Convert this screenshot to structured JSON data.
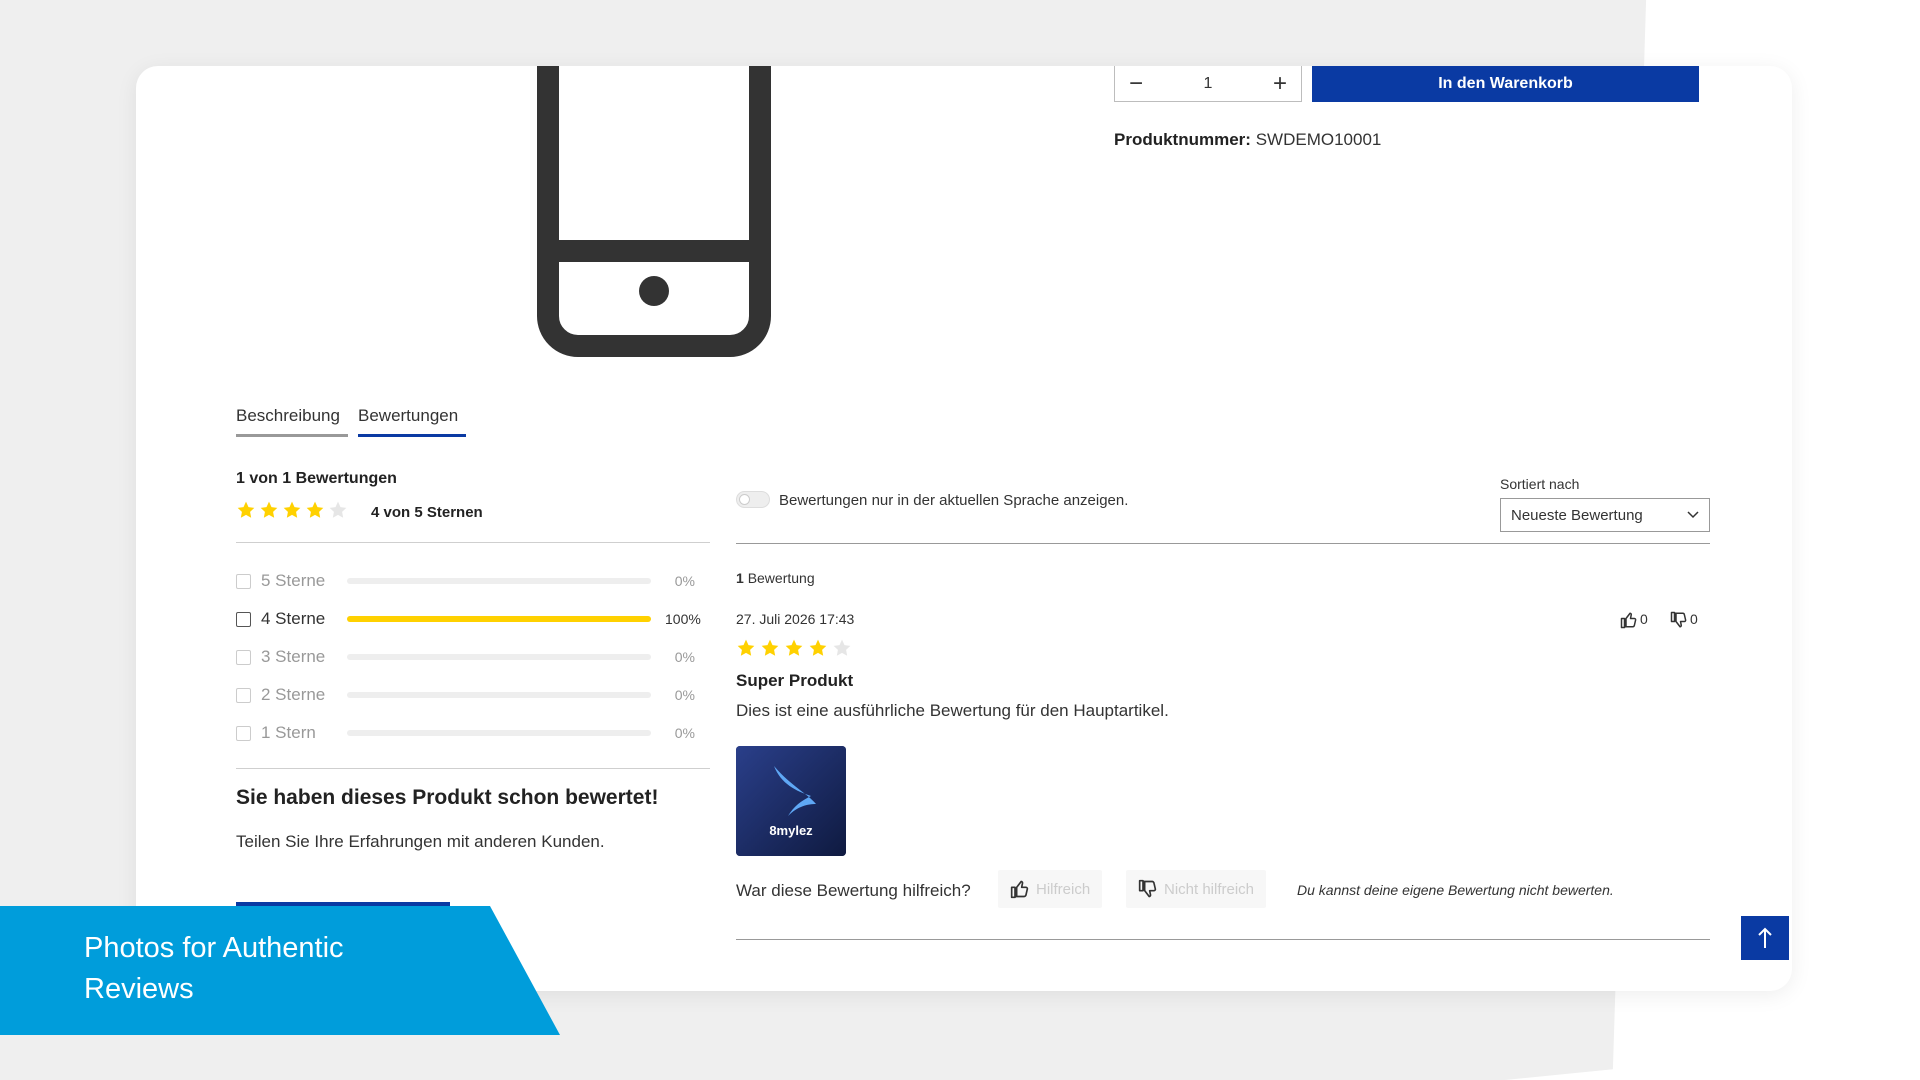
{
  "product": {
    "quantity": "1",
    "qty_minus": "−",
    "qty_plus": "+",
    "cart_button": "In den Warenkorb",
    "product_number_label": "Produktnummer:",
    "product_number_value": "SWDEMO10001"
  },
  "tabs": [
    {
      "label": "Beschreibung"
    },
    {
      "label": "Bewertungen"
    }
  ],
  "summary": {
    "title": "1 von 1 Bewertungen",
    "stars_filled": 4,
    "stars_total": 5,
    "stars_text": "4 von 5 Sternen"
  },
  "rating_filters": [
    {
      "label": "5 Sterne",
      "percent": 0,
      "percent_text": "0%"
    },
    {
      "label": "4 Sterne",
      "percent": 100,
      "percent_text": "100%"
    },
    {
      "label": "3 Sterne",
      "percent": 0,
      "percent_text": "0%"
    },
    {
      "label": "2 Sterne",
      "percent": 0,
      "percent_text": "0%"
    },
    {
      "label": "1 Stern",
      "percent": 0,
      "percent_text": "0%"
    }
  ],
  "rated": {
    "title": "Sie haben dieses Produkt schon bewertet!",
    "subtitle": "Teilen Sie Ihre Erfahrungen mit anderen Kunden."
  },
  "filter": {
    "toggle_label": "Bewertungen nur in der aktuellen Sprache anzeigen.",
    "sort_label": "Sortiert nach",
    "sort_value": "Neueste Bewertung"
  },
  "reviews": {
    "count_number": "1",
    "count_word": "Bewertung",
    "items": [
      {
        "date": "27. Juli 2026 17:43",
        "stars_filled": 4,
        "stars_total": 5,
        "title": "Super Produkt",
        "text": "Dies ist eine ausführliche Bewertung für den Hauptartikel.",
        "image_brand": "8mylez",
        "upvotes": "0",
        "downvotes": "0"
      }
    ],
    "helpful_question": "War diese Bewertung hilfreich?",
    "helpful_button": "Hilfreich",
    "not_helpful_button": "Nicht hilfreich",
    "own_review_note": "Du kannst deine eigene Bewertung nicht bewerten."
  },
  "banner": {
    "text": "Photos for Authentic Reviews"
  },
  "colors": {
    "primary": "#0a3aa3",
    "star": "#ffd100",
    "banner": "#009ddb"
  },
  "icons": {
    "phone": "smartphone-icon",
    "thumbs_up": "thumbs-up-icon",
    "thumbs_down": "thumbs-down-icon",
    "chevron": "chevron-down-icon",
    "arrow_up": "arrow-up-icon"
  }
}
